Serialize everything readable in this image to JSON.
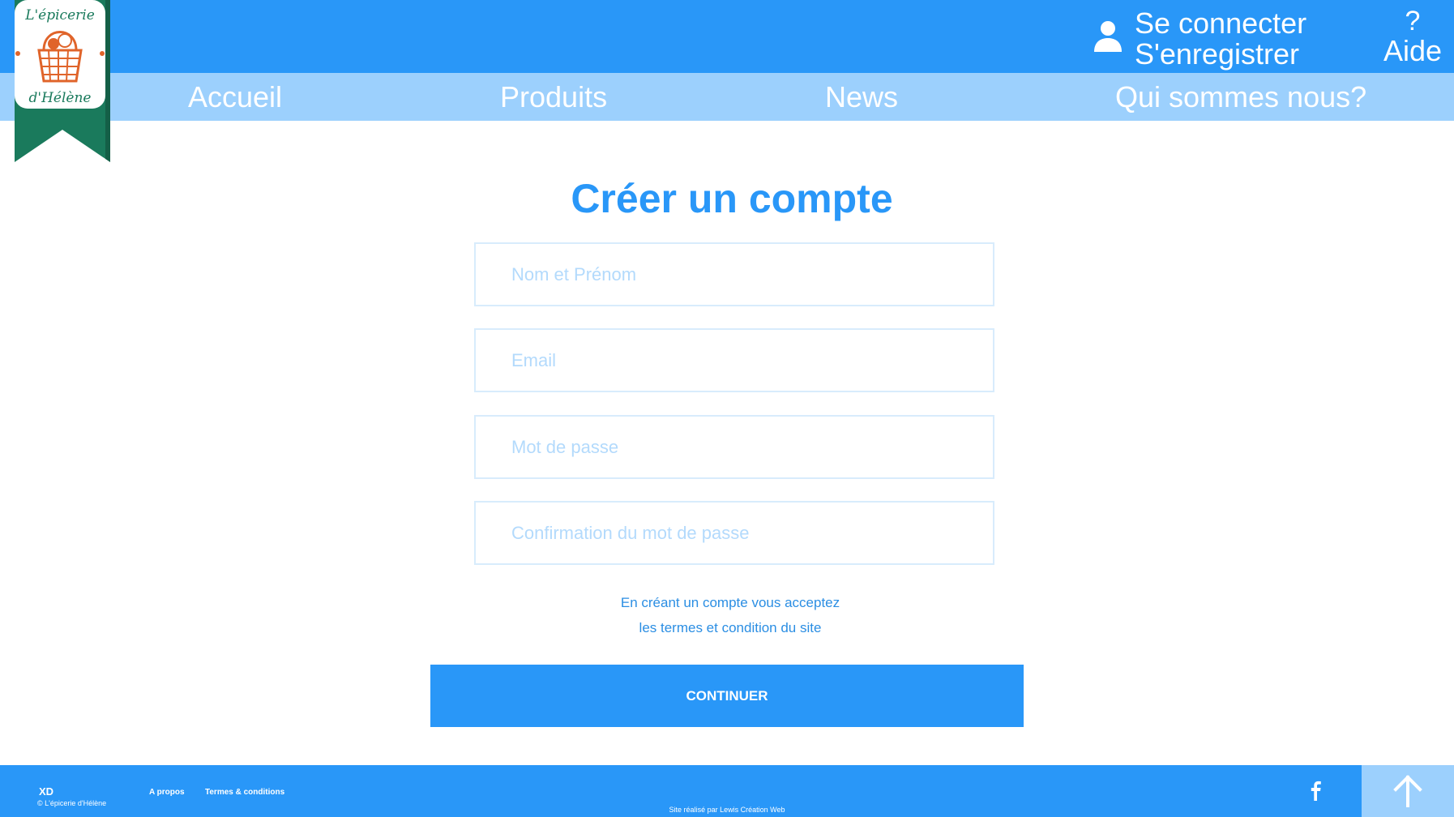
{
  "header": {
    "login_label": "Se connecter",
    "register_label": "S'enregistrer",
    "help_symbol": "?",
    "help_label": "Aide",
    "icons": {
      "account": "user-icon"
    }
  },
  "logo": {
    "text_top": "L'épicerie",
    "text_bottom": "d'Hélène"
  },
  "nav": {
    "items": [
      {
        "label": "Accueil"
      },
      {
        "label": "Produits"
      },
      {
        "label": "News"
      },
      {
        "label": "Qui sommes nous?"
      }
    ]
  },
  "form": {
    "title": "Créer un compte",
    "fields": [
      {
        "placeholder": "Nom et Prénom",
        "value": ""
      },
      {
        "placeholder": "Email",
        "value": ""
      },
      {
        "placeholder": "Mot de passe",
        "value": ""
      },
      {
        "placeholder": "Confirmation du mot de passe",
        "value": ""
      }
    ],
    "terms_line1": "En créant un compte vous acceptez",
    "terms_line2": "les termes et condition du site",
    "submit_label": "CONTINUER"
  },
  "footer": {
    "brand": "XD",
    "copyright": "© L'épicerie d'Hélène",
    "links": [
      {
        "label": "A propos"
      },
      {
        "label": "Termes & conditions"
      }
    ],
    "credit": "Site réalisé par Lewis Création Web",
    "icons": {
      "social": "facebook-icon",
      "scroll_top": "arrow-up-icon"
    }
  },
  "colors": {
    "primary": "#2997f8",
    "nav_background": "#9cd0fd",
    "placeholder": "#b3dafc",
    "logo_green": "#1a7a5c",
    "logo_orange": "#e0642a"
  }
}
